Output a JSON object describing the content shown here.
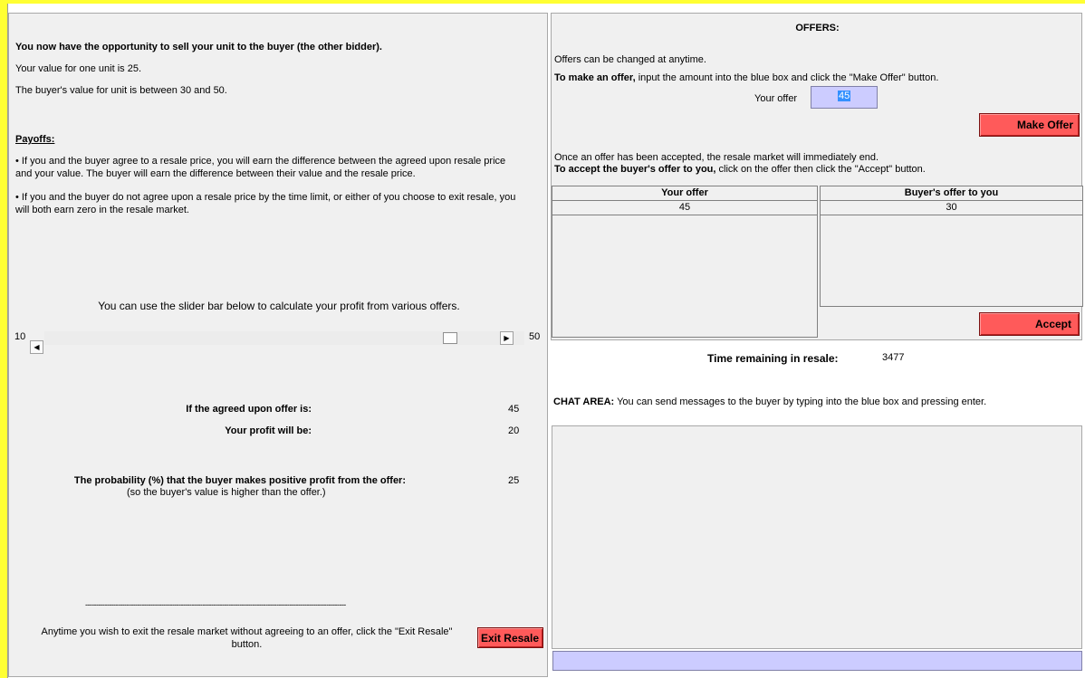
{
  "left": {
    "heading": "You now have the opportunity to sell your unit to the buyer (the other bidder).",
    "your_value": "Your value for one unit is 25.",
    "buyer_value": "The buyer's value for unit is between 30 and 50.",
    "payoffs_title": "Payoffs:",
    "payoff1_line1": "• If you and the buyer agree to a resale price, you will earn the difference between the agreed upon resale price",
    "payoff1_line2": "and your value. The buyer will earn the difference between their value and the resale price.",
    "payoff2_line1": "• If you and the buyer do not agree upon a resale price by the time limit, or either of you choose to exit resale, you",
    "payoff2_line2": "will both earn zero in the resale market.",
    "slider_note": "You can use the slider bar below to calculate your profit from various offers.",
    "slider": {
      "min_label": "10",
      "max_label": "50",
      "value": 45,
      "min": 10,
      "max": 50
    },
    "agreed_label": "If the agreed upon offer is:",
    "agreed_value": "45",
    "profit_label": "Your profit will be:",
    "profit_value": "20",
    "prob_label": "The probability (%) that the buyer makes positive profit from the offer:",
    "prob_note": "(so the buyer's value is higher than the offer.)",
    "prob_value": "25",
    "divider": "------------------------------------------------------------------------------------------------------------------------",
    "exit_line1": "Anytime you wish to exit the resale market without agreeing to an offer, click the \"Exit Resale\"",
    "exit_line2": "button.",
    "exit_button": "Exit Resale"
  },
  "offers": {
    "title": "OFFERS:",
    "changed_note": "Offers can be changed at anytime.",
    "make_offer_bold": "To make an offer,",
    "make_offer_rest": " input the amount into the blue box and click the \"Make Offer\" button.",
    "your_offer_label": "Your offer",
    "your_offer_value": "45",
    "make_offer_button": "Make Offer",
    "accepted_note": "Once an offer has been accepted, the resale market will immediately end.",
    "accept_bold": "To accept the buyer's offer to you,",
    "accept_rest": " click on the offer then click the \"Accept\" button.",
    "table_left_header": "Your offer",
    "table_left_value": "45",
    "table_right_header": "Buyer's offer to you",
    "table_right_value": "30",
    "accept_button": "Accept"
  },
  "timer": {
    "label": "Time remaining in resale:",
    "value": "3477"
  },
  "chat": {
    "bold": "CHAT AREA:",
    "rest": " You can send messages to the buyer by typing into the blue box and pressing enter.",
    "input_value": ""
  },
  "colors": {
    "background": "#ffff33",
    "button": "#ff5a5a",
    "input": "#ccccff"
  }
}
